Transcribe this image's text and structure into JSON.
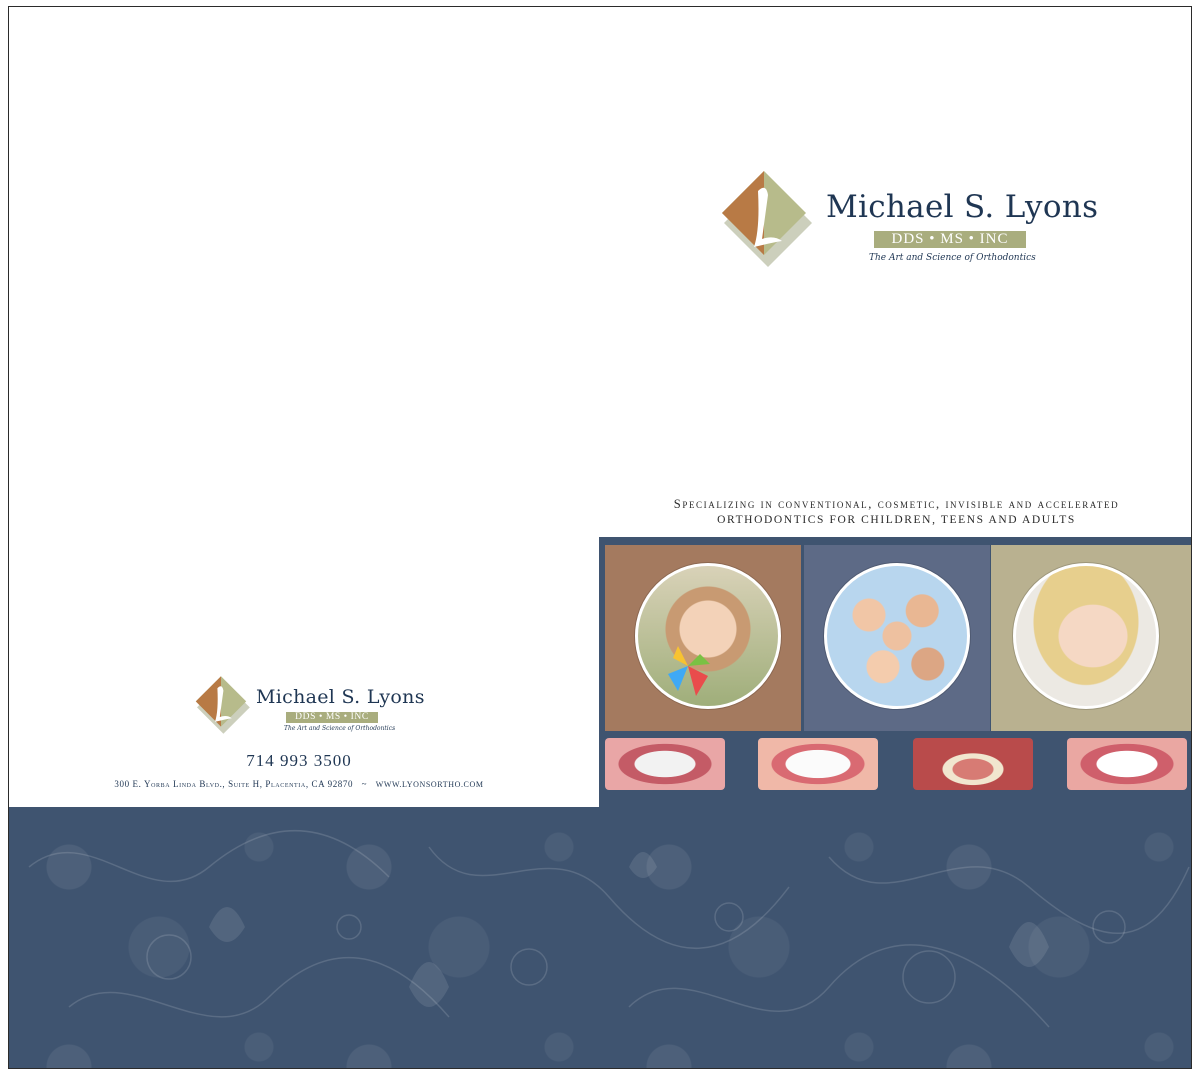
{
  "logo": {
    "name": "Michael S. Lyons",
    "credentials": "DDS • MS • INC",
    "tagline": "The Art and Science of Orthodontics",
    "colors": {
      "bronze": "#b87a45",
      "sage": "#a9ad7e",
      "navy": "#1f3653"
    }
  },
  "specialty": {
    "line1": "Specializing in conventional, cosmetic, invisible and accelerated",
    "line2": "orthodontics for children, teens and adults"
  },
  "contact": {
    "phone": "714 993 3500",
    "address": "300 E. Yorba Linda Blvd., Suite H, Placentia, CA 92870",
    "separator": "~",
    "website": "www.lyonsortho.com"
  },
  "panels": [
    {
      "image": "girl-smiling-photo",
      "bg": "#a47a5f"
    },
    {
      "image": "group-of-friends-photo",
      "bg": "#5d6a86"
    },
    {
      "image": "young-woman-smiling-photo",
      "bg": "#b9b190"
    }
  ],
  "teeth_images": [
    "metal-braces-teeth",
    "clear-braces-teeth",
    "lingual-braces-teeth",
    "invisible-aligner-teeth"
  ],
  "colors": {
    "navy_band": "#3f5470",
    "border": "#2b2b2b"
  }
}
